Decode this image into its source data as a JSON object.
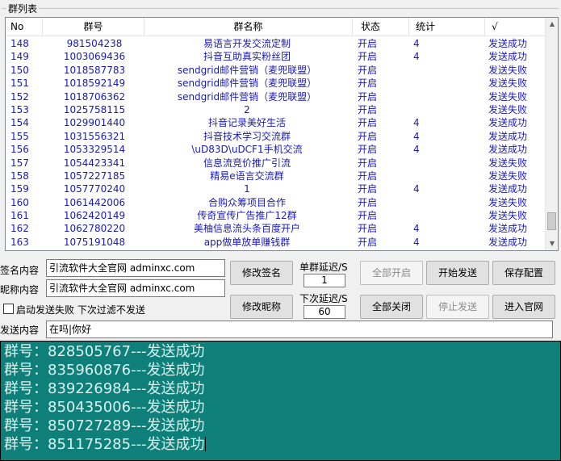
{
  "group_title": "群列表",
  "columns": {
    "no": "No",
    "id": "群号",
    "name": "群名称",
    "state": "状态",
    "count": "统计",
    "result": "√"
  },
  "rows": [
    {
      "no": "148",
      "id": "981504238",
      "name": "易语言开发交流定制",
      "state": "开启",
      "count": "4",
      "result": "发送成功"
    },
    {
      "no": "149",
      "id": "1003069436",
      "name": "抖音互助真实粉丝团",
      "state": "开启",
      "count": "4",
      "result": "发送成功"
    },
    {
      "no": "150",
      "id": "1018587783",
      "name": "sendgrid邮件营销（麦兜联盟）",
      "state": "开启",
      "count": "",
      "result": "发送失败"
    },
    {
      "no": "151",
      "id": "1018592149",
      "name": "sendgrid邮件营销（麦兜联盟）",
      "state": "开启",
      "count": "",
      "result": "发送失败"
    },
    {
      "no": "152",
      "id": "1018706362",
      "name": "sendgrid邮件营销（麦兜联盟）",
      "state": "开启",
      "count": "",
      "result": "发送失败"
    },
    {
      "no": "153",
      "id": "1025758115",
      "name": "2",
      "state": "开启",
      "count": "",
      "result": "发送失败"
    },
    {
      "no": "154",
      "id": "1029901440",
      "name": "抖音记录美好生活",
      "state": "开启",
      "count": "4",
      "result": "发送成功"
    },
    {
      "no": "155",
      "id": "1031556321",
      "name": "抖音技术学习交流群",
      "state": "开启",
      "count": "4",
      "result": "发送成功"
    },
    {
      "no": "156",
      "id": "1053329514",
      "name": "\\uD83D\\uDCF1手机交流",
      "state": "开启",
      "count": "4",
      "result": "发送成功"
    },
    {
      "no": "157",
      "id": "1054423341",
      "name": "信息流竞价推广引流",
      "state": "开启",
      "count": "",
      "result": "发送失败"
    },
    {
      "no": "158",
      "id": "1057227185",
      "name": "精易e语言交流群",
      "state": "开启",
      "count": "",
      "result": "发送失败"
    },
    {
      "no": "159",
      "id": "1057770240",
      "name": "1",
      "state": "开启",
      "count": "4",
      "result": "发送成功"
    },
    {
      "no": "160",
      "id": "1061442006",
      "name": "合购众筹项目合作",
      "state": "开启",
      "count": "",
      "result": "发送失败"
    },
    {
      "no": "161",
      "id": "1062420149",
      "name": "传奇宣传广告推广12群",
      "state": "开启",
      "count": "",
      "result": "发送失败"
    },
    {
      "no": "162",
      "id": "1062780220",
      "name": "美柚信息流头条百度开户",
      "state": "开启",
      "count": "4",
      "result": "发送成功"
    },
    {
      "no": "163",
      "id": "1075191048",
      "name": "app做单放单赚钱群",
      "state": "开启",
      "count": "4",
      "result": "发送成功"
    }
  ],
  "controls": {
    "sign_label": "签名内容",
    "sign_value": "引流软件大全官网 adminxc.com",
    "nick_label": "昵称内容",
    "nick_value": "引流软件大全官网 adminxc.com",
    "modify_sign": "修改签名",
    "modify_nick": "修改昵称",
    "single_delay_label": "单群延迟/S",
    "single_delay_value": "1",
    "next_delay_label": "下次延迟/S",
    "next_delay_value": "60",
    "all_open": "全部开启",
    "all_close": "全部关闭",
    "start_send": "开始发送",
    "stop_send": "停止发送",
    "save_config": "保存配置",
    "enter_site": "进入官网",
    "checkbox_label": "启动发送失败  下次过滤不发送",
    "send_label": "发送内容",
    "send_value": "在吗|你好"
  },
  "log": [
    "群号：828505767---发送成功",
    "群号：835960876---发送成功",
    "群号：839226984---发送成功",
    "群号：850435006---发送成功",
    "群号：850727289---发送成功",
    "群号：851175285---发送成功"
  ]
}
